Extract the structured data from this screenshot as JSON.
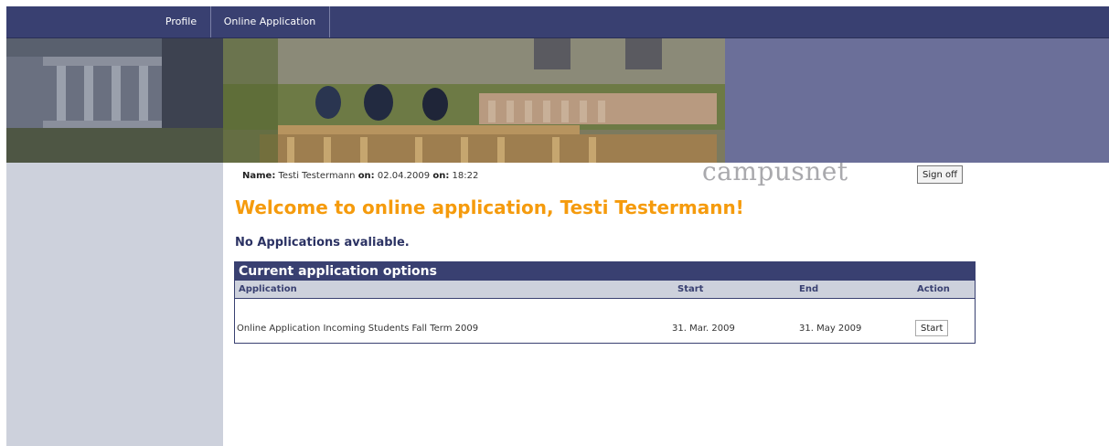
{
  "nav": {
    "items": [
      "Profile",
      "Online Application"
    ]
  },
  "user": {
    "name_label": "Name:",
    "name": "Testi Testermann",
    "on_label": "on:",
    "date": "02.04.2009",
    "time": "18:22"
  },
  "brand": "campusnet",
  "signoff": "Sign off",
  "welcome": "Welcome to online application, Testi Testermann!",
  "no_apps": "No Applications avaliable.",
  "table": {
    "caption": "Current application options",
    "columns": [
      "Application",
      "Start",
      "End",
      "Action"
    ],
    "rows": [
      {
        "application": "Online Application Incoming Students Fall Term 2009",
        "start": "31. Mar. 2009",
        "end": "31. May 2009",
        "action": "Start"
      }
    ]
  }
}
